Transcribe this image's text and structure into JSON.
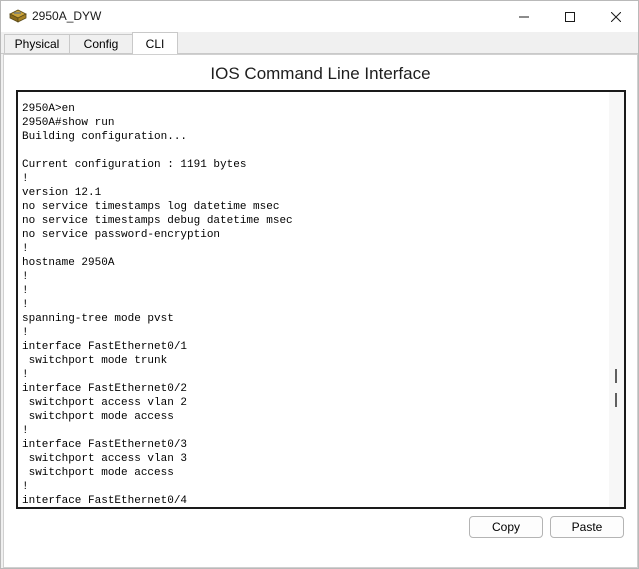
{
  "window": {
    "title": "2950A_DYW"
  },
  "tabs": [
    {
      "label": "Physical"
    },
    {
      "label": "Config"
    },
    {
      "label": "CLI"
    }
  ],
  "cli": {
    "heading": "IOS Command Line Interface",
    "output": "2950A>en\n2950A#show run\nBuilding configuration...\n\nCurrent configuration : 1191 bytes\n!\nversion 12.1\nno service timestamps log datetime msec\nno service timestamps debug datetime msec\nno service password-encryption\n!\nhostname 2950A\n!\n!\n!\nspanning-tree mode pvst\n!\ninterface FastEthernet0/1\n switchport mode trunk\n!\ninterface FastEthernet0/2\n switchport access vlan 2\n switchport mode access\n!\ninterface FastEthernet0/3\n switchport access vlan 3\n switchport mode access\n!\ninterface FastEthernet0/4"
  },
  "buttons": {
    "copy": "Copy",
    "paste": "Paste"
  },
  "icons": {
    "app": "switch-icon",
    "minimize": "minimize-icon",
    "maximize": "maximize-icon",
    "close": "close-icon"
  },
  "colors": {
    "active_tab": "#ffffff",
    "terminal_border": "#1a1a1a"
  }
}
